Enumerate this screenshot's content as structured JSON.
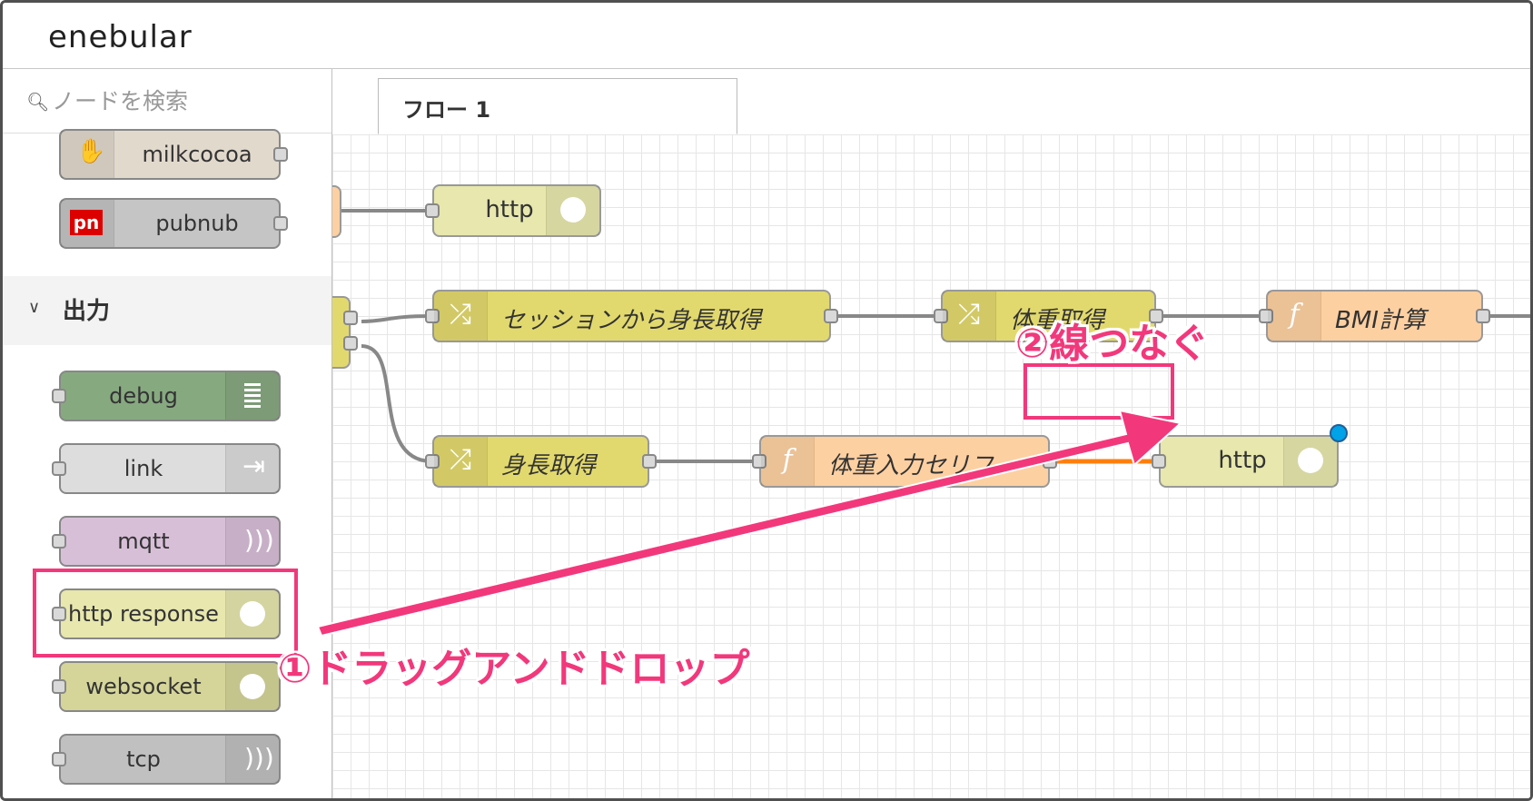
{
  "app": {
    "logo": "enebular"
  },
  "palette": {
    "search_placeholder": "ノードを検索",
    "top_nodes": [
      {
        "label": "milkcocoa",
        "icon": "milkcocoa-icon",
        "color": "#e2d9cd"
      },
      {
        "label": "pubnub",
        "icon": "pubnub-icon",
        "color": "#c5c5c5"
      }
    ],
    "output_category": "出力",
    "output_nodes": [
      {
        "label": "debug",
        "icon": "list-icon",
        "color": "#87a980"
      },
      {
        "label": "link",
        "icon": "link-out-icon",
        "color": "#dddddd"
      },
      {
        "label": "mqtt",
        "icon": "bridge-icon",
        "color": "#d8bfd8"
      },
      {
        "label": "http response",
        "icon": "globe-icon",
        "color": "#e7e7ae"
      },
      {
        "label": "websocket",
        "icon": "globe-icon",
        "color": "#d5d59a"
      },
      {
        "label": "tcp",
        "icon": "bridge-icon",
        "color": "#c0c0c0"
      }
    ]
  },
  "workspace": {
    "tab_label": "フロー 1",
    "nodes": {
      "http_top": "http",
      "session_height": "セッションから身長取得",
      "weight_get": "体重取得",
      "bmi": "BMI計算",
      "height_get": "身長取得",
      "weight_line": "体重入力セリフ",
      "http_new": "http"
    },
    "colors": {
      "change": "#e2d96e",
      "function": "#fdd0a2",
      "http": "#e7e7ae",
      "wire": "#888888",
      "new_wire": "#ff7f0e",
      "annotation": "#f2387b"
    }
  },
  "annotations": {
    "step1": "①ドラッグアンドドロップ",
    "step2": "②線つなぐ"
  }
}
